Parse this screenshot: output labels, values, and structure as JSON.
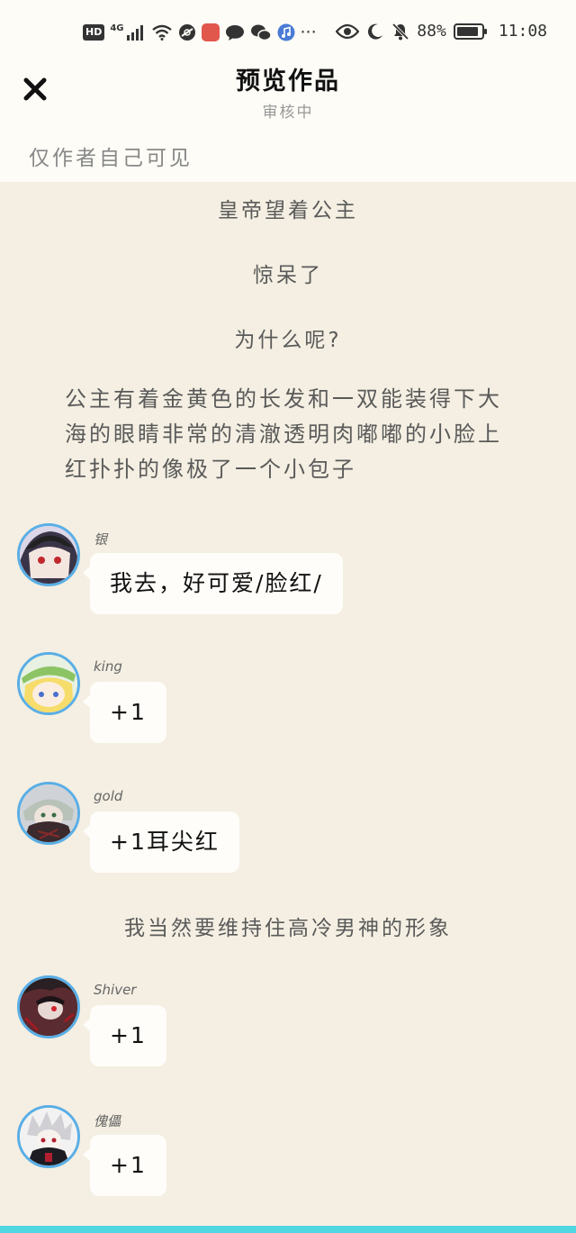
{
  "status_bar": {
    "hd_label": "HD",
    "network_label": "4G",
    "more_label": "···",
    "battery_percent": "88%",
    "battery_level": 0.88,
    "time": "11:08"
  },
  "header": {
    "title": "预览作品",
    "subtitle": "审核中",
    "visibility_note": "仅作者自己可见"
  },
  "story": {
    "narration_1": "皇帝望着公主",
    "narration_2": "惊呆了",
    "narration_3": "为什么呢?",
    "paragraph": "公主有着金黄色的长发和一双能装得下大海的眼睛非常的清澈透明肉嘟嘟的小脸上红扑扑的像极了一个小包子",
    "narration_4": "我当然要维持住高冷男神的形象"
  },
  "messages": [
    {
      "name": "银",
      "text": "我去，好可爱/脸红/"
    },
    {
      "name": "king",
      "text": "+1"
    },
    {
      "name": "gold",
      "text": "+1耳尖红"
    },
    {
      "name": "Shiver",
      "text": "+1"
    },
    {
      "name": "傀儡",
      "text": "+1"
    }
  ],
  "colors": {
    "page_background": "#f4efe2",
    "header_background": "#fdfcf6",
    "avatar_ring": "#5aaee6",
    "bottom_accent": "#4fd6e0"
  }
}
